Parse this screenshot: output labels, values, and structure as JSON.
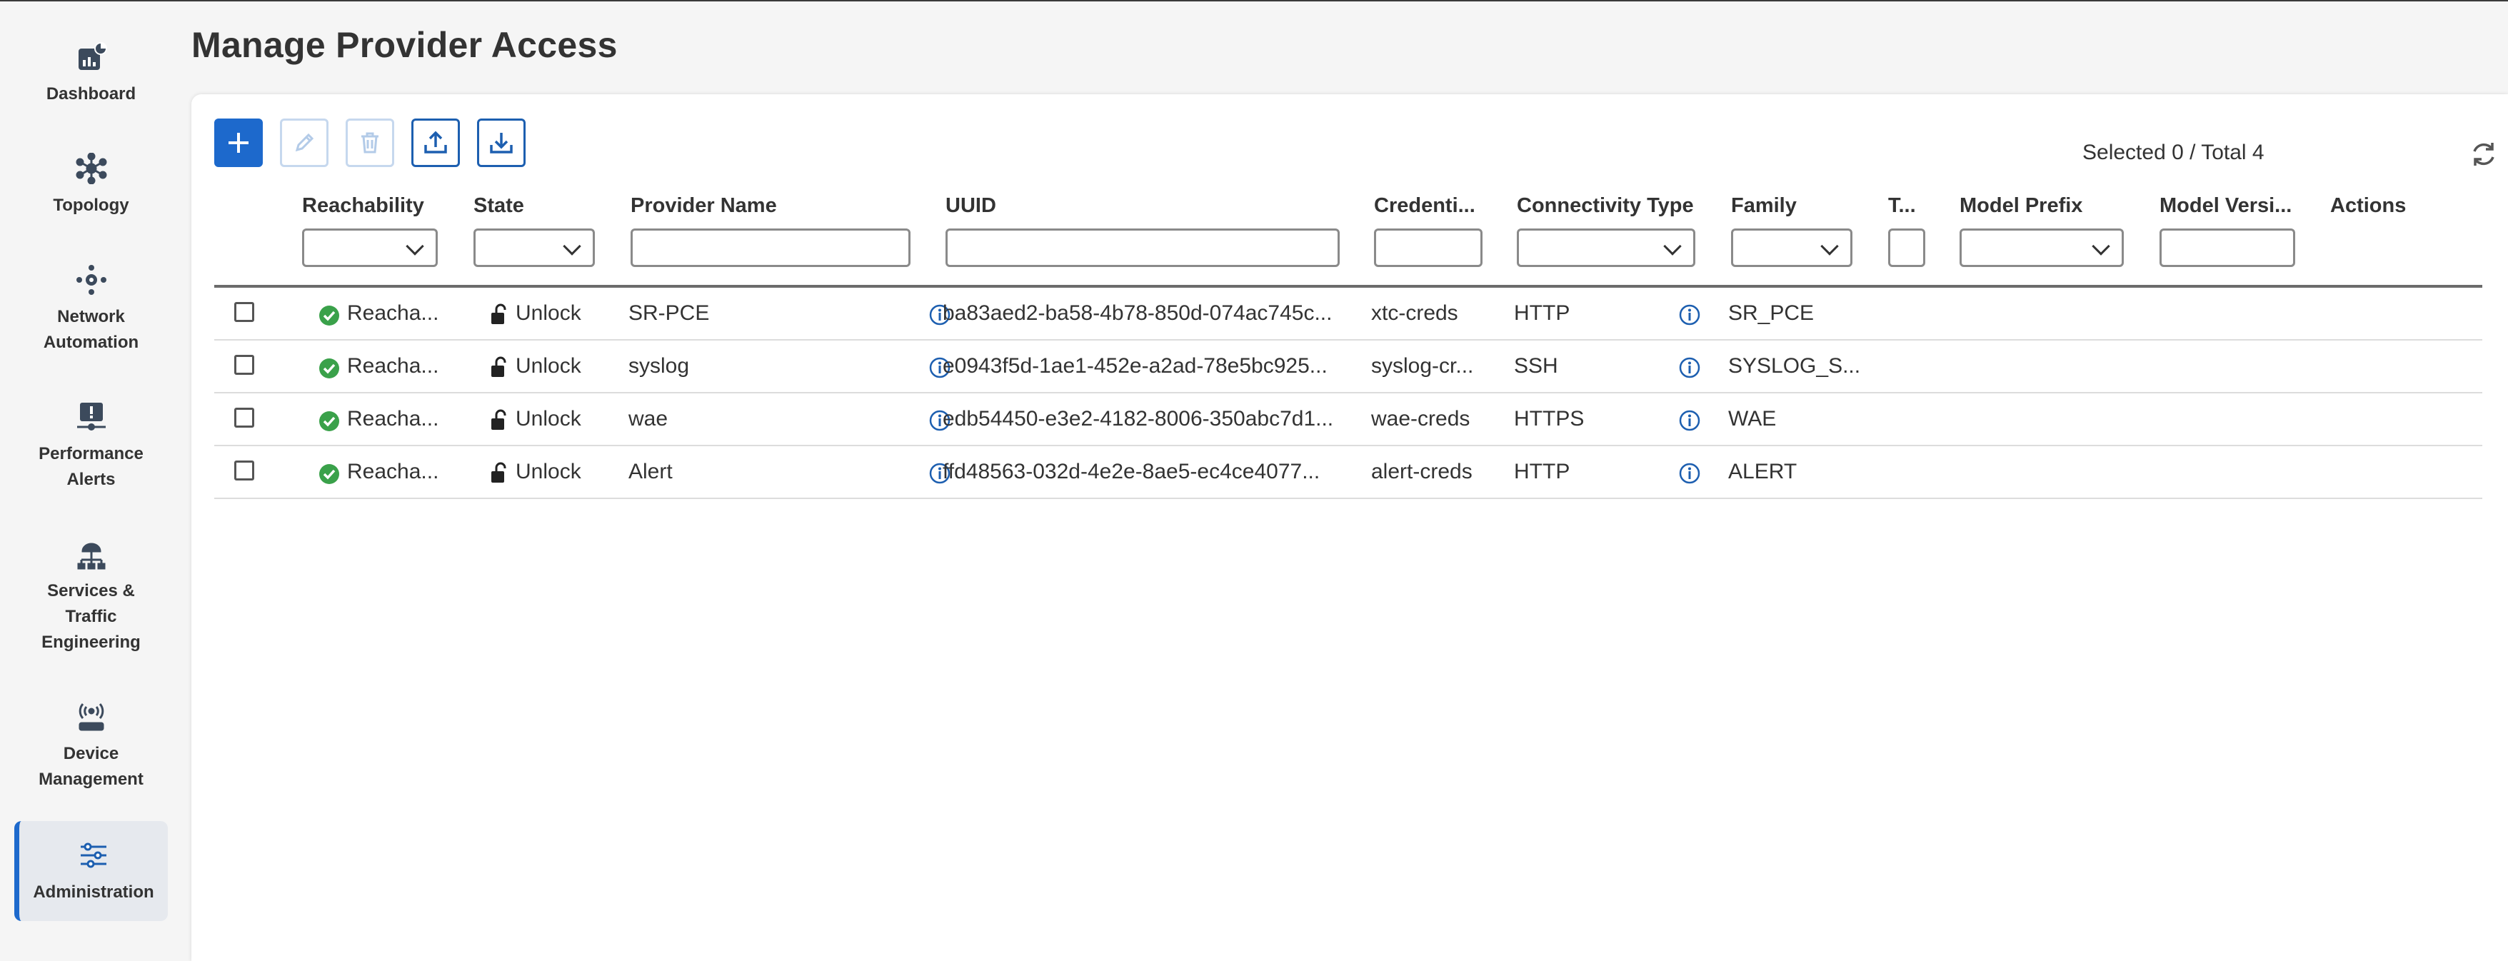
{
  "page": {
    "title": "Manage Provider Access"
  },
  "sidebar": {
    "items": [
      {
        "label": "Dashboard",
        "icon": "dashboard-icon",
        "active": false
      },
      {
        "label": "Topology",
        "icon": "topology-icon",
        "active": false
      },
      {
        "label": "Network\nAutomation",
        "icon": "network-automation-icon",
        "active": false
      },
      {
        "label": "Performance\nAlerts",
        "icon": "performance-alerts-icon",
        "active": false
      },
      {
        "label": "Services &\nTraffic\nEngineering",
        "icon": "services-icon",
        "active": false
      },
      {
        "label": "Device\nManagement",
        "icon": "device-management-icon",
        "active": false
      },
      {
        "label": "Administration",
        "icon": "administration-icon",
        "active": true
      }
    ]
  },
  "toolbar": {
    "buttons": [
      {
        "name": "add",
        "icon": "plus-icon",
        "enabled": true
      },
      {
        "name": "edit",
        "icon": "pencil-icon",
        "enabled": false
      },
      {
        "name": "delete",
        "icon": "trash-icon",
        "enabled": false
      },
      {
        "name": "export",
        "icon": "upload-icon",
        "enabled": true
      },
      {
        "name": "import",
        "icon": "download-icon",
        "enabled": true
      }
    ],
    "selected_text": "Selected 0 / Total 4"
  },
  "table": {
    "columns": [
      {
        "label": "Reachability",
        "filter": "select"
      },
      {
        "label": "State",
        "filter": "select"
      },
      {
        "label": "Provider Name",
        "filter": "text"
      },
      {
        "label": "UUID",
        "filter": "text"
      },
      {
        "label": "Credenti...",
        "filter": "text"
      },
      {
        "label": "Connectivity Type",
        "filter": "select"
      },
      {
        "label": "Family",
        "filter": "select"
      },
      {
        "label": "T...",
        "filter": "text"
      },
      {
        "label": "Model Prefix",
        "filter": "select"
      },
      {
        "label": "Model Versi...",
        "filter": "text"
      },
      {
        "label": "Actions",
        "filter": "none"
      }
    ],
    "rows": [
      {
        "reachability": "Reacha...",
        "state": "Unlock",
        "provider": "SR-PCE",
        "uuid": "ba83aed2-ba58-4b78-850d-074ac745c...",
        "credentials": "xtc-creds",
        "connectivity": "HTTP",
        "family": "SR_PCE"
      },
      {
        "reachability": "Reacha...",
        "state": "Unlock",
        "provider": "syslog",
        "uuid": "e0943f5d-1ae1-452e-a2ad-78e5bc925...",
        "credentials": "syslog-cr...",
        "connectivity": "SSH",
        "family": "SYSLOG_S..."
      },
      {
        "reachability": "Reacha...",
        "state": "Unlock",
        "provider": "wae",
        "uuid": "edb54450-e3e2-4182-8006-350abc7d1...",
        "credentials": "wae-creds",
        "connectivity": "HTTPS",
        "family": "WAE"
      },
      {
        "reachability": "Reacha...",
        "state": "Unlock",
        "provider": "Alert",
        "uuid": "ffd48563-032d-4e2e-8ae5-ec4ce4077...",
        "credentials": "alert-creds",
        "connectivity": "HTTP",
        "family": "ALERT"
      }
    ]
  },
  "colors": {
    "accent": "#1d69cc",
    "reachable": "#3aa14a",
    "info": "#1d5fb0"
  }
}
